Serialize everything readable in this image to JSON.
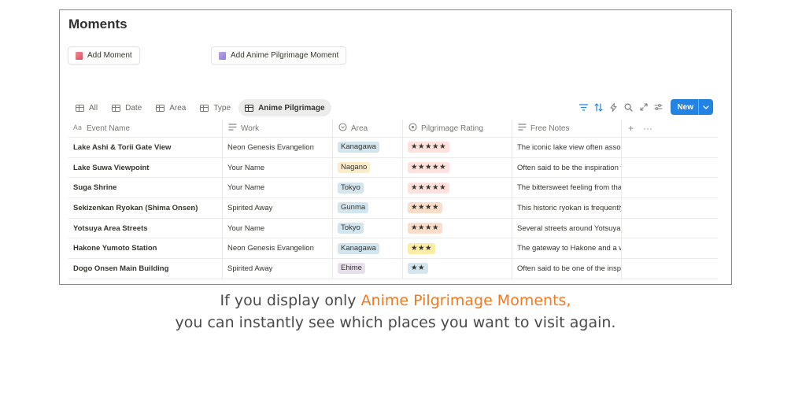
{
  "page": {
    "title": "Moments"
  },
  "templates": {
    "add_moment": "Add Moment",
    "add_anime_moment": "Add Anime Pilgrimage Moment"
  },
  "views": [
    {
      "label": "All",
      "active": false
    },
    {
      "label": "Date",
      "active": false
    },
    {
      "label": "Area",
      "active": false
    },
    {
      "label": "Type",
      "active": false
    },
    {
      "label": "Anime Pilgrimage",
      "active": true
    }
  ],
  "toolbar": {
    "new_label": "New",
    "accent_color": "#2383e2",
    "icons": [
      "filter-icon",
      "sort-icon",
      "automation-bolt-icon",
      "search-icon",
      "expand-icon",
      "settings-sliders-icon"
    ]
  },
  "columns": {
    "name": "Event Name",
    "work": "Work",
    "area": "Area",
    "rating": "Pilgrimage Rating",
    "notes": "Free Notes"
  },
  "rows": [
    {
      "name": "Lake Ashi & Torii Gate View",
      "work": "Neon Genesis Evangelion",
      "area": "Kanagawa",
      "area_color": "#d3e5ef",
      "rating": "★★★★★",
      "rating_color": "#ffe2dd",
      "notes": "The iconic lake view often associated"
    },
    {
      "name": "Lake Suwa Viewpoint",
      "work": "Your Name",
      "area": "Nagano",
      "area_color": "#fdecc8",
      "rating": "★★★★★",
      "rating_color": "#ffe2dd",
      "notes": "Often said to be the inspiration for"
    },
    {
      "name": "Suga Shrine",
      "work": "Your Name",
      "area": "Tokyo",
      "area_color": "#d3e5ef",
      "rating": "★★★★★",
      "rating_color": "#ffe2dd",
      "notes": "The bittersweet feeling from that"
    },
    {
      "name": "Sekizenkan Ryokan (Shima Onsen)",
      "work": "Spirited Away",
      "area": "Gunma",
      "area_color": "#d3e5ef",
      "rating": "★★★★",
      "rating_color": "#fadec9",
      "notes": "This historic ryokan is frequently"
    },
    {
      "name": "Yotsuya Area Streets",
      "work": "Your Name",
      "area": "Tokyo",
      "area_color": "#d3e5ef",
      "rating": "★★★★",
      "rating_color": "#fadec9",
      "notes": "Several streets around Yotsuya"
    },
    {
      "name": "Hakone Yumoto Station",
      "work": "Neon Genesis Evangelion",
      "area": "Kanagawa",
      "area_color": "#d3e5ef",
      "rating": "★★★",
      "rating_color": "#fbeca8",
      "notes": "The gateway to Hakone and a well"
    },
    {
      "name": "Dogo Onsen Main Building",
      "work": "Spirited Away",
      "area": "Ehime",
      "area_color": "#e8deee",
      "rating": "★★",
      "rating_color": "#d3e5ef",
      "notes": "Often said to be one of the inspirations"
    }
  ],
  "caption": {
    "line1_prefix": "If you display only ",
    "line1_highlight": "Anime Pilgrimage Moments,",
    "line2": "you can instantly see which places you want to visit again.",
    "highlight_color": "#f07a22"
  }
}
